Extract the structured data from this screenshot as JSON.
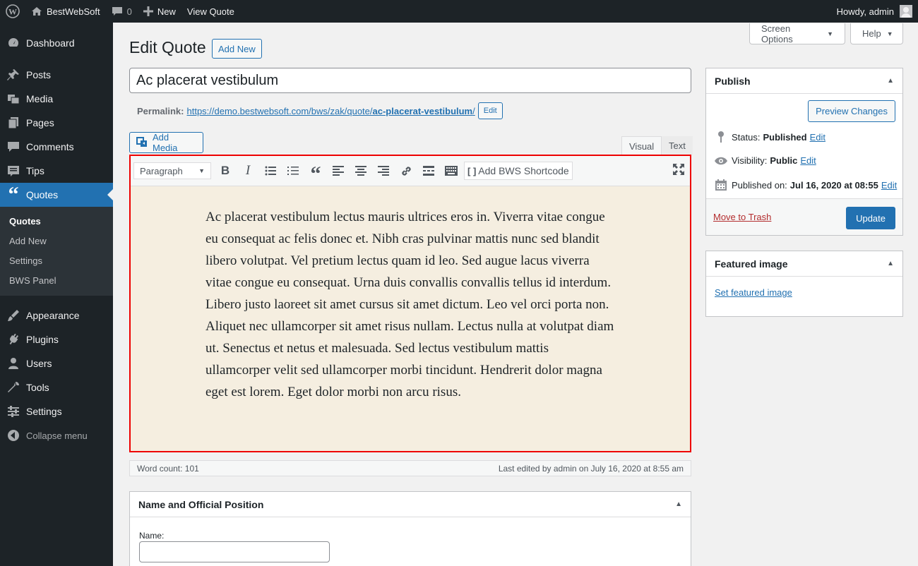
{
  "adminbar": {
    "site_name": "BestWebSoft",
    "comments_count": "0",
    "new_label": "New",
    "view_label": "View Quote",
    "greeting": "Howdy, admin"
  },
  "sidebar": {
    "items": [
      {
        "label": "Dashboard",
        "icon": "dashboard-icon"
      },
      {
        "label": "Posts",
        "icon": "pin-icon"
      },
      {
        "label": "Media",
        "icon": "media-icon"
      },
      {
        "label": "Pages",
        "icon": "pages-icon"
      },
      {
        "label": "Comments",
        "icon": "comment-icon"
      },
      {
        "label": "Tips",
        "icon": "tips-icon"
      },
      {
        "label": "Quotes",
        "icon": "quote-icon"
      }
    ],
    "submenu": [
      "Quotes",
      "Add New",
      "Settings",
      "BWS Panel"
    ],
    "items2": [
      {
        "label": "Appearance",
        "icon": "brush-icon"
      },
      {
        "label": "Plugins",
        "icon": "plugin-icon"
      },
      {
        "label": "Users",
        "icon": "user-icon"
      },
      {
        "label": "Tools",
        "icon": "wrench-icon"
      },
      {
        "label": "Settings",
        "icon": "settings-icon"
      }
    ],
    "collapse_label": "Collapse menu"
  },
  "screen_options_label": "Screen Options",
  "help_label": "Help",
  "page": {
    "title": "Edit Quote",
    "add_new_label": "Add New",
    "post_title": "Ac placerat vestibulum",
    "permalink_label": "Permalink:",
    "permalink_base": "https://demo.bestwebsoft.com/bws/zak/quote/",
    "permalink_slug": "ac-placerat-vestibulum",
    "permalink_end": "/",
    "permalink_edit": "Edit"
  },
  "editor": {
    "add_media_label": "Add Media",
    "tab_visual": "Visual",
    "tab_text": "Text",
    "format_value": "Paragraph",
    "bws_shortcode_label": "Add BWS Shortcode",
    "content": "Ac placerat vestibulum lectus mauris ultrices eros in. Viverra vitae congue eu consequat ac felis donec et. Nibh cras pulvinar mattis nunc sed blandit libero volutpat. Vel pretium lectus quam id leo. Sed augue lacus viverra vitae congue eu consequat. Urna duis convallis convallis tellus id interdum. Libero justo laoreet sit amet cursus sit amet dictum. Leo vel orci porta non. Aliquet nec ullamcorper sit amet risus nullam. Lectus nulla at volutpat diam ut. Senectus et netus et malesuada. Sed lectus vestibulum mattis ullamcorper velit sed ullamcorper morbi tincidunt. Hendrerit dolor magna eget est lorem. Eget dolor morbi non arcu risus.",
    "word_count": "Word count: 101",
    "last_edited": "Last edited by admin on July 16, 2020 at 8:55 am"
  },
  "name_box": {
    "title": "Name and Official Position",
    "name_label": "Name:",
    "name_value": ""
  },
  "publish": {
    "title": "Publish",
    "preview_label": "Preview Changes",
    "status_label": "Status:",
    "status_value": "Published",
    "visibility_label": "Visibility:",
    "visibility_value": "Public",
    "published_label": "Published on:",
    "published_value": "Jul 16, 2020 at 08:55",
    "edit_label": "Edit",
    "trash_label": "Move to Trash",
    "update_label": "Update"
  },
  "featured": {
    "title": "Featured image",
    "link_label": "Set featured image"
  },
  "colors": {
    "accent": "#2271b1",
    "adminbar": "#1d2327",
    "highlight_border": "#e00000",
    "editor_bg": "#f5eee0"
  }
}
